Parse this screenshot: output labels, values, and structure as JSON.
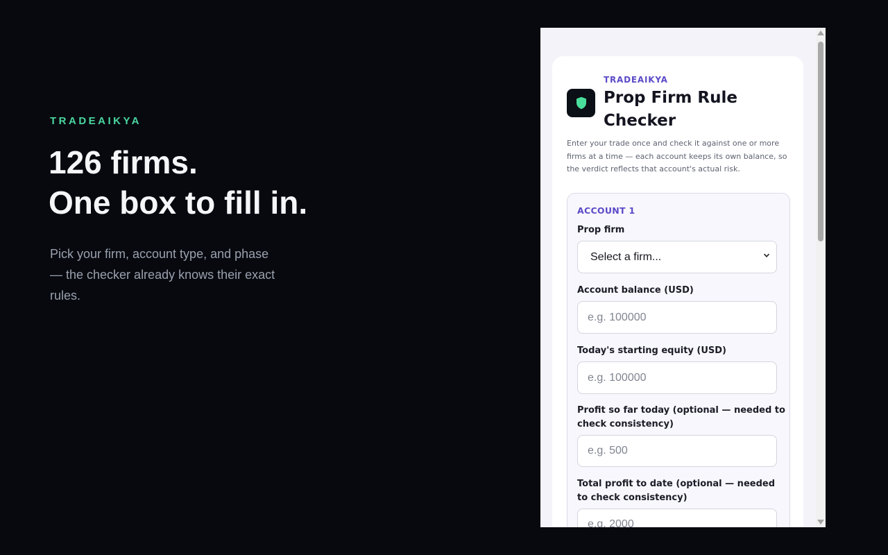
{
  "hero": {
    "brand": "TRADEAIKYA",
    "title_line1": "126 firms.",
    "title_line2": "One box to fill in.",
    "subtitle": "Pick your firm, account type, and phase — the checker already knows their exact rules."
  },
  "popup": {
    "brand": "TRADEAIKYA",
    "title": "Prop Firm Rule Checker",
    "logo_icon": "shield-icon",
    "description": "Enter your trade once and check it against one or more firms at a time — each account keeps its own balance, so the verdict reflects that account's actual risk.",
    "account": {
      "title": "ACCOUNT 1",
      "prop_firm_label": "Prop firm",
      "prop_firm_selected": "Select a firm...",
      "balance_label": "Account balance (USD)",
      "balance_placeholder": "e.g. 100000",
      "equity_label": "Today's starting equity (USD)",
      "equity_placeholder": "e.g. 100000",
      "profit_today_label": "Profit so far today (optional — needed to check consistency)",
      "profit_today_placeholder": "e.g. 500",
      "total_profit_label": "Total profit to date (optional — needed to check consistency)",
      "total_profit_placeholder": "e.g. 2000"
    }
  },
  "colors": {
    "page_background": "#07090f",
    "hero_brand": "#4ad7a0",
    "popup_accent": "#5b4bc8",
    "shield_icon": "#4ade9c"
  }
}
